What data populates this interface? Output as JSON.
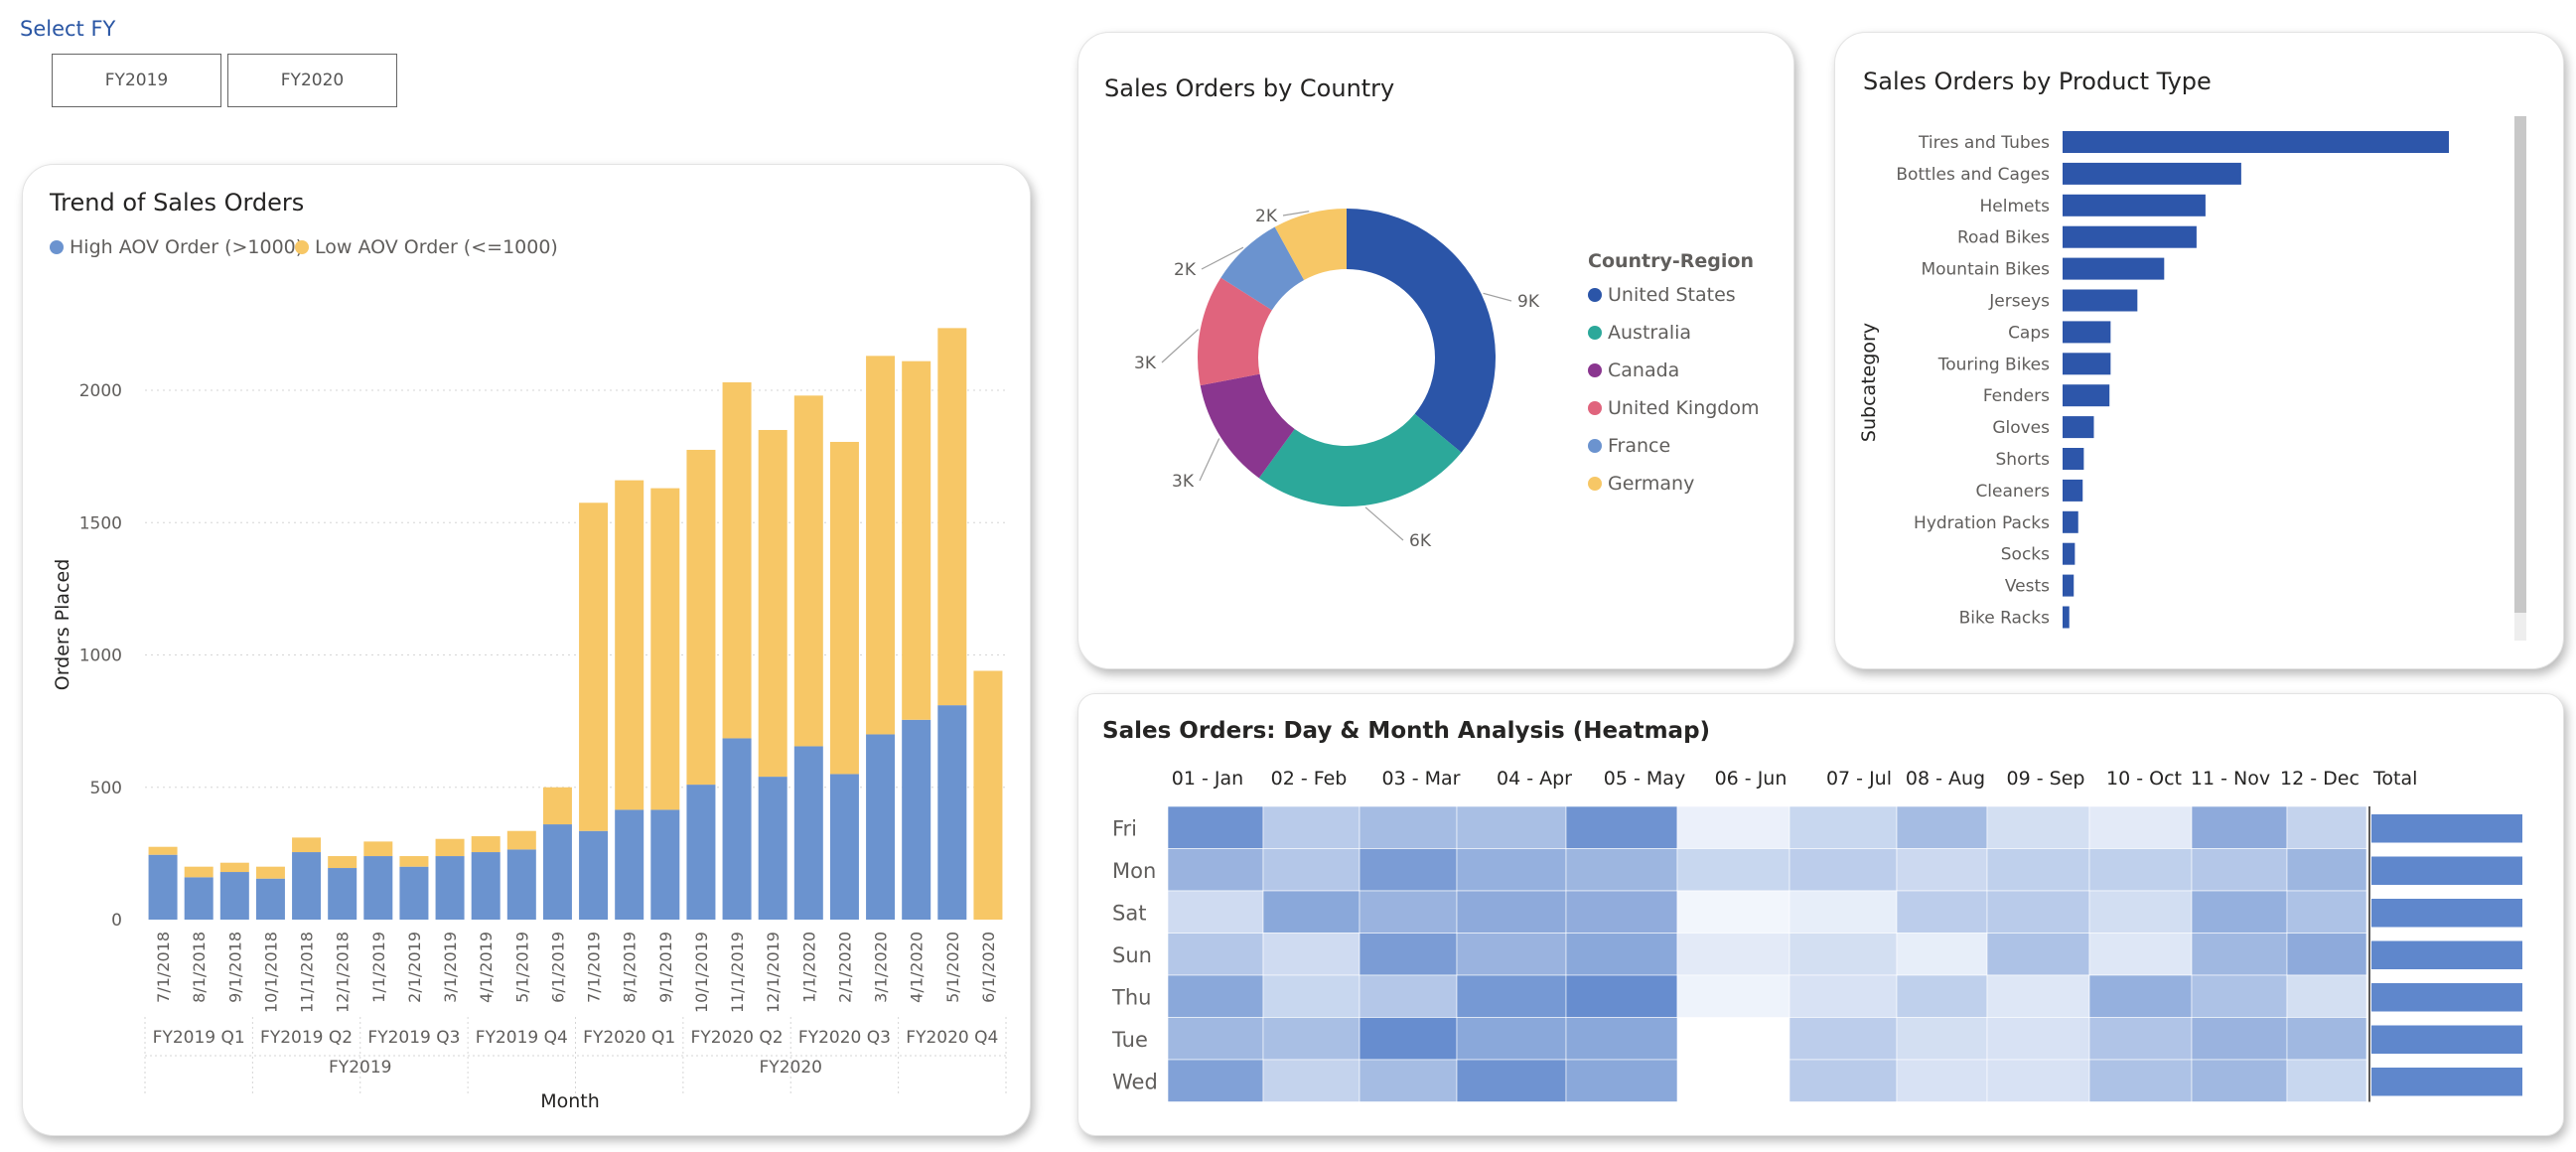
{
  "slicer": {
    "title": "Select FY",
    "buttons": [
      "FY2019",
      "FY2020"
    ]
  },
  "colors": {
    "high_aov": "#6b93cf",
    "low_aov": "#f7c766",
    "bar_blue": "#2d56aa",
    "heat_max": "#5f87cc",
    "title_blue": "#2a56a4"
  },
  "trend": {
    "title": "Trend of Sales Orders",
    "legend": [
      {
        "label": "High AOV Order (>1000)",
        "color": "#6b93cf"
      },
      {
        "label": "Low AOV Order (<=1000)",
        "color": "#f7c766"
      }
    ],
    "xlabel": "Month",
    "ylabel": "Orders Placed",
    "quarters": [
      "FY2019 Q1",
      "FY2019 Q2",
      "FY2019 Q3",
      "FY2019 Q4",
      "FY2020 Q1",
      "FY2020 Q2",
      "FY2020 Q3",
      "FY2020 Q4"
    ],
    "years": [
      "FY2019",
      "FY2020"
    ]
  },
  "country": {
    "title": "Sales Orders by Country",
    "legend_title": "Country-Region",
    "segment_labels": [
      "9K",
      "6K",
      "3K",
      "3K",
      "2K",
      "2K"
    ]
  },
  "product": {
    "title": "Sales Orders by Product Type",
    "axis_label": "Subcategory"
  },
  "heatmap": {
    "title": "Sales Orders: Day & Month Analysis (Heatmap)",
    "columns": [
      "01 - Jan",
      "02 - Feb",
      "03 - Mar",
      "04 - Apr",
      "05 - May",
      "06 - Jun",
      "07 - Jul",
      "08 - Aug",
      "09 - Sep",
      "10 - Oct",
      "11 - Nov",
      "12 - Dec"
    ],
    "total_label": "Total",
    "rows": [
      {
        "day": "Fri",
        "values": [
          0.9,
          0.42,
          0.55,
          0.52,
          0.9,
          0.1,
          0.32,
          0.55,
          0.25,
          0.15,
          0.7,
          0.35
        ],
        "total": 1.0
      },
      {
        "day": "Mon",
        "values": [
          0.62,
          0.45,
          0.82,
          0.65,
          0.6,
          0.32,
          0.4,
          0.3,
          0.38,
          0.38,
          0.45,
          0.6
        ],
        "total": 1.0
      },
      {
        "day": "Sat",
        "values": [
          0.28,
          0.72,
          0.62,
          0.7,
          0.68,
          0.05,
          0.12,
          0.4,
          0.42,
          0.26,
          0.65,
          0.5
        ],
        "total": 1.0
      },
      {
        "day": "Sun",
        "values": [
          0.45,
          0.28,
          0.82,
          0.62,
          0.72,
          0.15,
          0.25,
          0.12,
          0.5,
          0.18,
          0.58,
          0.7
        ],
        "total": 1.0
      },
      {
        "day": "Thu",
        "values": [
          0.72,
          0.32,
          0.45,
          0.85,
          0.95,
          0.08,
          0.22,
          0.38,
          0.18,
          0.65,
          0.5,
          0.25
        ],
        "total": 1.0
      },
      {
        "day": "Tue",
        "values": [
          0.58,
          0.52,
          0.95,
          0.72,
          0.72,
          null,
          0.4,
          0.25,
          0.22,
          0.48,
          0.62,
          0.58
        ],
        "total": 1.0
      },
      {
        "day": "Wed",
        "values": [
          0.78,
          0.35,
          0.55,
          0.9,
          0.72,
          null,
          0.42,
          0.22,
          0.22,
          0.5,
          0.58,
          0.32
        ],
        "total": 1.0
      }
    ]
  },
  "chart_data": [
    {
      "type": "bar",
      "stacked": true,
      "title": "Trend of Sales Orders",
      "xlabel": "Month",
      "ylabel": "Orders Placed",
      "ylim": [
        0,
        2400
      ],
      "yticks": [
        0,
        500,
        1000,
        1500,
        2000
      ],
      "grid": true,
      "legend": "top-left",
      "categories": [
        "7/1/2018",
        "8/1/2018",
        "9/1/2018",
        "10/1/2018",
        "11/1/2018",
        "12/1/2018",
        "1/1/2019",
        "2/1/2019",
        "3/1/2019",
        "4/1/2019",
        "5/1/2019",
        "6/1/2019",
        "7/1/2019",
        "8/1/2019",
        "9/1/2019",
        "10/1/2019",
        "11/1/2019",
        "12/1/2019",
        "1/1/2020",
        "2/1/2020",
        "3/1/2020",
        "4/1/2020",
        "5/1/2020",
        "6/1/2020"
      ],
      "series": [
        {
          "name": "High AOV Order (>1000)",
          "values": [
            245,
            160,
            180,
            155,
            255,
            195,
            240,
            200,
            240,
            255,
            265,
            360,
            335,
            415,
            415,
            510,
            685,
            540,
            655,
            550,
            700,
            755,
            810,
            0
          ]
        },
        {
          "name": "Low AOV Order (<=1000)",
          "values": [
            30,
            40,
            35,
            45,
            55,
            45,
            55,
            40,
            65,
            60,
            70,
            140,
            1240,
            1245,
            1215,
            1265,
            1345,
            1310,
            1325,
            1255,
            1430,
            1355,
            1425,
            940
          ]
        }
      ]
    },
    {
      "type": "pie",
      "donut": true,
      "title": "Sales Orders by Country",
      "legend": "right",
      "categories": [
        "United States",
        "Australia",
        "Canada",
        "United Kingdom",
        "France",
        "Germany"
      ],
      "values": [
        9000,
        6000,
        3000,
        3000,
        2000,
        2000
      ],
      "colors": [
        "#2b55a8",
        "#2ca89a",
        "#8a368f",
        "#e0647d",
        "#6b93cf",
        "#f7c766"
      ]
    },
    {
      "type": "bar",
      "orientation": "horizontal",
      "title": "Sales Orders by Product Type",
      "ylabel": "Subcategory",
      "categories": [
        "Tires and Tubes",
        "Bottles and Cages",
        "Helmets",
        "Road Bikes",
        "Mountain Bikes",
        "Jerseys",
        "Caps",
        "Touring Bikes",
        "Fenders",
        "Gloves",
        "Shorts",
        "Cleaners",
        "Hydration Packs",
        "Socks",
        "Vests",
        "Bike Racks"
      ],
      "values": [
        17300,
        8000,
        6400,
        6000,
        4550,
        3350,
        2150,
        2150,
        2100,
        1400,
        950,
        900,
        700,
        550,
        500,
        300
      ]
    }
  ]
}
